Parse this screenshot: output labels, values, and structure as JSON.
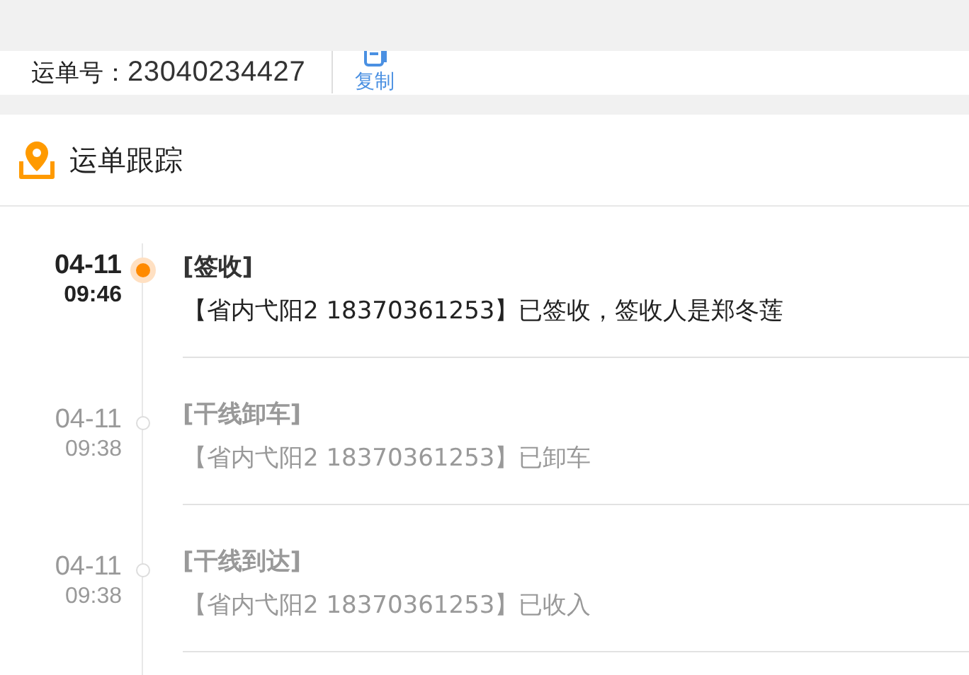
{
  "waybill": {
    "label": "运单号：",
    "number": "23040234427",
    "copy_button": "复制"
  },
  "tracking": {
    "title": "运单跟踪",
    "events": [
      {
        "date": "04-11",
        "time": "09:46",
        "status": "[签收]",
        "detail": "【省内弋阳2 18370361253】已签收，签收人是郑冬莲",
        "active": true
      },
      {
        "date": "04-11",
        "time": "09:38",
        "status": "[干线卸车]",
        "detail": "【省内弋阳2 18370361253】已卸车",
        "active": false
      },
      {
        "date": "04-11",
        "time": "09:38",
        "status": "[干线到达]",
        "detail": "【省内弋阳2 18370361253】已收入",
        "active": false
      }
    ]
  }
}
